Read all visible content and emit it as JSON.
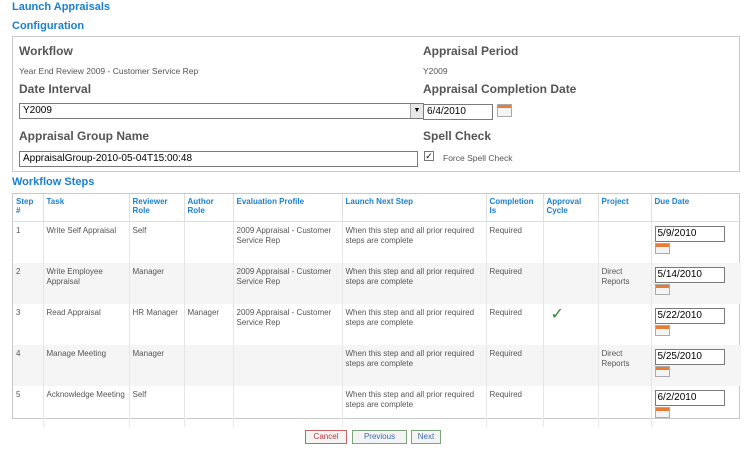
{
  "page": {
    "title": "Launch Appraisals"
  },
  "config": {
    "section_title": "Configuration",
    "workflow_label": "Workflow",
    "workflow_value": "Year End Review 2009 - Customer Service Rep",
    "period_label": "Appraisal Period",
    "period_value": "Y2009",
    "date_interval_label": "Date Interval",
    "date_interval_value": "Y2009",
    "completion_date_label": "Appraisal Completion Date",
    "completion_date_value": "6/4/2010",
    "group_name_label": "Appraisal Group Name",
    "group_name_value": "AppraisalGroup-2010-05-04T15:00:48",
    "spell_check_label": "Spell Check",
    "force_spell_check_label": "Force Spell Check",
    "force_spell_check_checked": true
  },
  "workflow": {
    "section_title": "Workflow Steps",
    "headers": {
      "step": "Step #",
      "task": "Task",
      "reviewer_role": "Reviewer Role",
      "author_role": "Author Role",
      "evaluation_profile": "Evaluation Profile",
      "launch_next_step": "Launch Next Step",
      "completion_is": "Completion Is",
      "approval_cycle": "Approval Cycle",
      "project": "Project",
      "due_date": "Due Date"
    },
    "rows": [
      {
        "step": "1",
        "task": "Write Self Appraisal",
        "reviewer_role": "Self",
        "author_role": "",
        "evaluation_profile": "2009 Appraisal - Customer Service Rep",
        "launch_next_step": "When this step and all prior required steps are complete",
        "completion_is": "Required",
        "approval_cycle": false,
        "project": "",
        "due_date": "5/9/2010"
      },
      {
        "step": "2",
        "task": "Write Employee Appraisal",
        "reviewer_role": "Manager",
        "author_role": "",
        "evaluation_profile": "2009 Appraisal - Customer Service Rep",
        "launch_next_step": "When this step and all prior required steps are complete",
        "completion_is": "Required",
        "approval_cycle": false,
        "project": "Direct Reports",
        "due_date": "5/14/2010"
      },
      {
        "step": "3",
        "task": "Read Appraisal",
        "reviewer_role": "HR Manager",
        "author_role": "Manager",
        "evaluation_profile": "2009 Appraisal - Customer Service Rep",
        "launch_next_step": "When this step and all prior required steps are complete",
        "completion_is": "Required",
        "approval_cycle": true,
        "project": "",
        "due_date": "5/22/2010"
      },
      {
        "step": "4",
        "task": "Manage Meeting",
        "reviewer_role": "Manager",
        "author_role": "",
        "evaluation_profile": "",
        "launch_next_step": "When this step and all prior required steps are complete",
        "completion_is": "Required",
        "approval_cycle": false,
        "project": "Direct Reports",
        "due_date": "5/25/2010"
      },
      {
        "step": "5",
        "task": "Acknowledge Meeting",
        "reviewer_role": "Self",
        "author_role": "",
        "evaluation_profile": "",
        "launch_next_step": "When this step and all prior required steps are complete",
        "completion_is": "Required",
        "approval_cycle": false,
        "project": "",
        "due_date": "6/2/2010"
      }
    ]
  },
  "buttons": {
    "cancel": "Cancel",
    "previous": "Previous",
    "next": "Next"
  },
  "colors": {
    "accent": "#1a7fd0",
    "check": "#2e8b2e",
    "calendar_accent": "#ea7b36"
  },
  "icons": {
    "calendar": "calendar-icon",
    "approval": "checkmark-icon",
    "dropdown": "chevron-down-icon"
  }
}
